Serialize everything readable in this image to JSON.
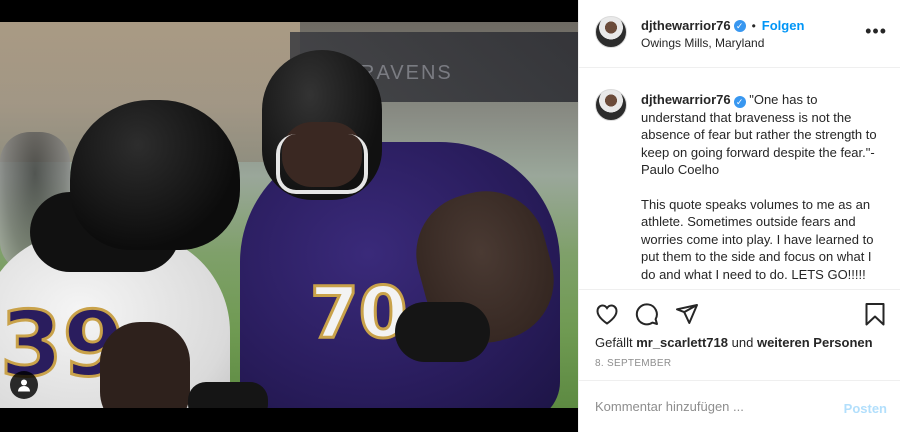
{
  "post": {
    "username": "djthewarrior76",
    "location": "Owings Mills, Maryland",
    "follow_label": "Folgen",
    "separator": "•",
    "more_glyph": "•••",
    "verified_glyph": "✓"
  },
  "media": {
    "banner_text": "RAVENS",
    "jersey_right": "70",
    "jersey_left": "39",
    "tag_icon": "person-icon"
  },
  "caption": {
    "username": "djthewarrior76",
    "quote": "\"One has to understand that braveness is not the absence of fear but rather the strength to keep on going forward despite the fear.\"-Paulo Coelho",
    "body": "This quote speaks volumes to me as an athlete. Sometimes outside fears and worries come into play. I have learned to put them to the side and focus on what I do and what I need to do. LETS GO!!!!!"
  },
  "actions": {
    "icons": [
      "heart-icon",
      "comment-icon",
      "share-icon",
      "bookmark-icon"
    ],
    "likes_prefix": "Gefällt",
    "likes_user": "mr_scarlett718",
    "likes_mid": "und",
    "likes_others": "weiteren Personen",
    "date": "8. SEPTEMBER"
  },
  "comment": {
    "placeholder": "Kommentar hinzufügen ...",
    "post_label": "Posten"
  },
  "colors": {
    "accent": "#0095f6",
    "post_disabled": "#b2dffc",
    "ravens_purple": "#2a1d5e",
    "ravens_gold": "#c9a24a"
  }
}
